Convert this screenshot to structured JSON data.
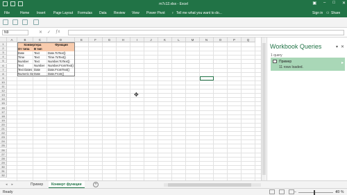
{
  "window": {
    "title": "m7c12.xlsx - Excel"
  },
  "ribbon": {
    "tabs": [
      "File",
      "Home",
      "Insert",
      "Page Layout",
      "Formulas",
      "Data",
      "Review",
      "View",
      "Power Pivot"
    ],
    "tell_me": "Tell me what you want to do...",
    "sign_in": "Sign in",
    "share": "Share"
  },
  "formula_bar": {
    "name_box": "N9",
    "value": ""
  },
  "grid": {
    "columns": [
      "A",
      "B",
      "C",
      "D",
      "E",
      "F",
      "G",
      "H",
      "I",
      "J",
      "K",
      "L",
      "M",
      "N",
      "O",
      "P",
      "Q"
    ],
    "rows": [
      "1",
      "2",
      "3",
      "4",
      "5",
      "6",
      "7",
      "8",
      "9",
      "10",
      "11",
      "12",
      "13",
      "14",
      "15",
      "16",
      "17",
      "18",
      "19",
      "20",
      "21",
      "22",
      "23",
      "24",
      "25",
      "26",
      "27",
      "28",
      "29",
      "30",
      "31",
      "32"
    ],
    "table": {
      "title": "Конвертера",
      "func_header": "Функция",
      "col_from": "От типа",
      "col_to": "В тип",
      "rows": [
        {
          "from": "Date",
          "to": "Text",
          "func": "Date.ToText()"
        },
        {
          "from": "Time",
          "to": "Text",
          "func": "Time.ToText()"
        },
        {
          "from": "Number",
          "to": "Text",
          "func": "Number.ToText()"
        },
        {
          "from": "Text",
          "to": "Number",
          "func": "Number.FromText()"
        },
        {
          "from": "Text Dates",
          "to": "Date",
          "func": "Date.FromText()"
        },
        {
          "from": "Numeric Date",
          "to": "Date",
          "func": "Date.From()"
        }
      ]
    }
  },
  "queries_pane": {
    "title": "Workbook Queries",
    "subtitle": "1 query",
    "query_name": "Пример",
    "query_status": "11 rows loaded."
  },
  "sheets": {
    "tabs": [
      "Пример",
      "Конверт функции"
    ],
    "active": "Конверт функции"
  },
  "status": {
    "ready": "Ready",
    "zoom": "80 %"
  },
  "colors": {
    "accent": "#217346",
    "header_fill": "#f8cbad",
    "query_fill": "#a9d7b7"
  }
}
